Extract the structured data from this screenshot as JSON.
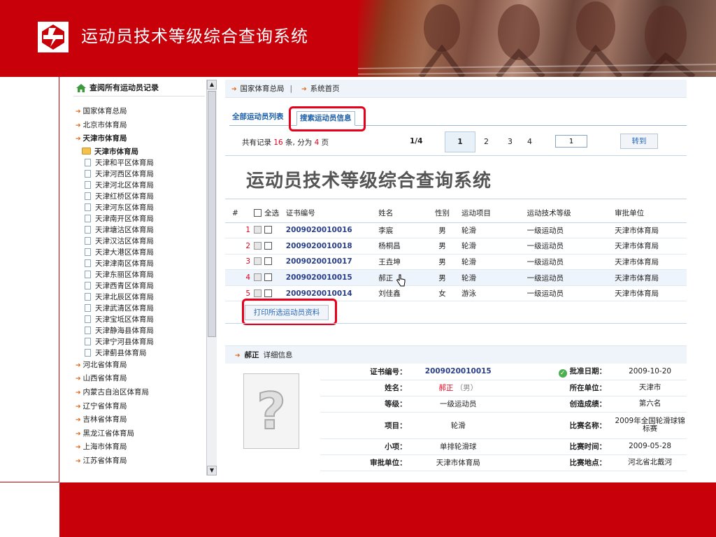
{
  "banner": {
    "title": "运动员技术等级综合查询系统"
  },
  "sidebar": {
    "header": "查阅所有运动员记录",
    "top_items": [
      "国家体育总局",
      "北京市体育局"
    ],
    "expanded_item": "天津市体育局",
    "sub_header": "天津市体育局",
    "sub_items": [
      "天津和平区体育局",
      "天津河西区体育局",
      "天津河北区体育局",
      "天津红桥区体育局",
      "天津河东区体育局",
      "天津南开区体育局",
      "天津塘沽区体育局",
      "天津汉沽区体育局",
      "天津大港区体育局",
      "天津津南区体育局",
      "天津东丽区体育局",
      "天津西青区体育局",
      "天津北辰区体育局",
      "天津武清区体育局",
      "天津宝坻区体育局",
      "天津静海县体育局",
      "天津宁河县体育局",
      "天津蓟县体育局"
    ],
    "bottom_items": [
      "河北省体育局",
      "山西省体育局",
      "内蒙古自治区体育局",
      "辽宁省体育局",
      "吉林省体育局",
      "黑龙江省体育局",
      "上海市体育局",
      "江苏省体育局"
    ]
  },
  "breadcrumb": {
    "root": "国家体育总局",
    "sep": "|",
    "page": "系统首页"
  },
  "tabs": {
    "all": "全部运动员列表",
    "search": "搜索运动员信息"
  },
  "pager": {
    "prefix": "共有记录 ",
    "total": "16",
    "mid": " 条, 分为 ",
    "pages": "4",
    "suffix": " 页",
    "page_indicator": "1/4",
    "pages_list": [
      "1",
      "2",
      "3",
      "4"
    ],
    "goto_value": "1",
    "goto_label": "转到"
  },
  "main_title": "运动员技术等级综合查询系统",
  "table": {
    "headers": {
      "no": "#",
      "select_all": "全选",
      "code": "证书编号",
      "name": "姓名",
      "sex": "性别",
      "sport": "运动项目",
      "level": "运动技术等级",
      "unit": "审批单位"
    },
    "rows": [
      {
        "no": "1",
        "code": "2009020010016",
        "name": "李宸",
        "sex": "男",
        "sport": "轮滑",
        "level": "一级运动员",
        "unit": "天津市体育局"
      },
      {
        "no": "2",
        "code": "2009020010018",
        "name": "杨桐昌",
        "sex": "男",
        "sport": "轮滑",
        "level": "一级运动员",
        "unit": "天津市体育局"
      },
      {
        "no": "3",
        "code": "2009020010017",
        "name": "王垚坤",
        "sex": "男",
        "sport": "轮滑",
        "level": "一级运动员",
        "unit": "天津市体育局"
      },
      {
        "no": "4",
        "code": "2009020010015",
        "name": "郝正",
        "sex": "男",
        "sport": "轮滑",
        "level": "一级运动员",
        "unit": "天津市体育局"
      },
      {
        "no": "5",
        "code": "2009020010014",
        "name": "刘佳鑫",
        "sex": "女",
        "sport": "游泳",
        "level": "一级运动员",
        "unit": "天津市体育局"
      }
    ]
  },
  "print_label": "打印所选运动员资料",
  "detail": {
    "name": "郝正",
    "title_suffix": "详细信息",
    "labels": {
      "code": "证书编号：",
      "name": "姓名：",
      "level": "等级：",
      "event": "项目：",
      "sub_event": "小项：",
      "unit": "审批单位：",
      "approve_date": "批准日期：",
      "location": "所在单位：",
      "result": "创造成绩：",
      "match": "比赛名称：",
      "match_time": "比赛时间：",
      "match_place": "比赛地点："
    },
    "values": {
      "code": "2009020010015",
      "name": "郝正",
      "sex": "（男）",
      "level": "一级运动员",
      "event": "轮滑",
      "sub_event": "单排轮滑球",
      "unit": "天津市体育局",
      "approve_date": "2009-10-20",
      "location": "天津市",
      "result": "第六名",
      "match": "2009年全国轮滑球锦标赛",
      "match_time": "2009-05-28",
      "match_place": "河北省北戴河"
    },
    "photo_placeholder": "?"
  },
  "colors": {
    "brand_red": "#c8000a",
    "highlight_red": "#e8001a",
    "link_blue": "#2a3f8a"
  }
}
